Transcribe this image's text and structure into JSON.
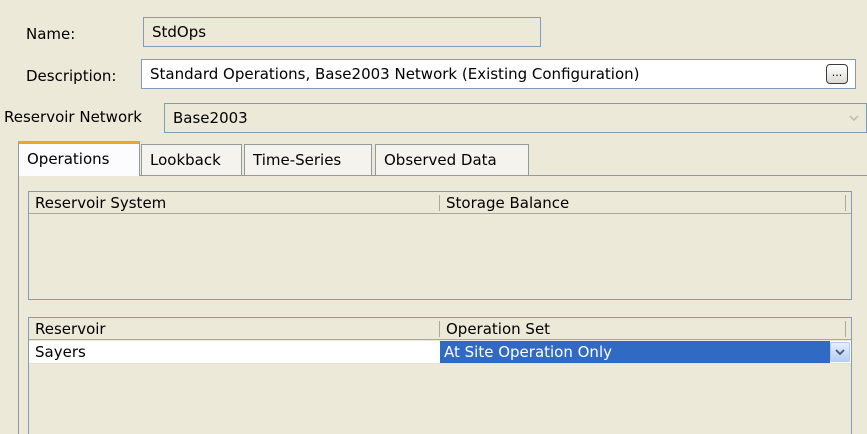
{
  "form": {
    "name_label": "Name:",
    "name_value": "StdOps",
    "description_label": "Description:",
    "description_value": "Standard Operations, Base2003 Network (Existing Configuration)",
    "description_button": "...",
    "network_label": "Reservoir Network",
    "network_value": "Base2003"
  },
  "tabs": [
    {
      "label": "Operations",
      "active": true
    },
    {
      "label": "Lookback",
      "active": false
    },
    {
      "label": "Time-Series",
      "active": false
    },
    {
      "label": "Observed Data",
      "active": false
    }
  ],
  "system_table": {
    "columns": [
      "Reservoir System",
      "Storage Balance"
    ],
    "rows": []
  },
  "reservoir_table": {
    "columns": [
      "Reservoir",
      "Operation Set"
    ],
    "rows": [
      {
        "reservoir": "Sayers",
        "operation_set": "At Site Operation Only",
        "selected": true
      }
    ]
  },
  "icons": {
    "ellipsis": "ellipsis-icon",
    "network_dropdown": "chevron-down-icon",
    "operation_dropdown": "chevron-down-icon"
  },
  "colors": {
    "background": "#ece9d8",
    "selection": "#316ac5",
    "active_tab_accent": "#f2a226",
    "field_border": "#7f9db9"
  }
}
